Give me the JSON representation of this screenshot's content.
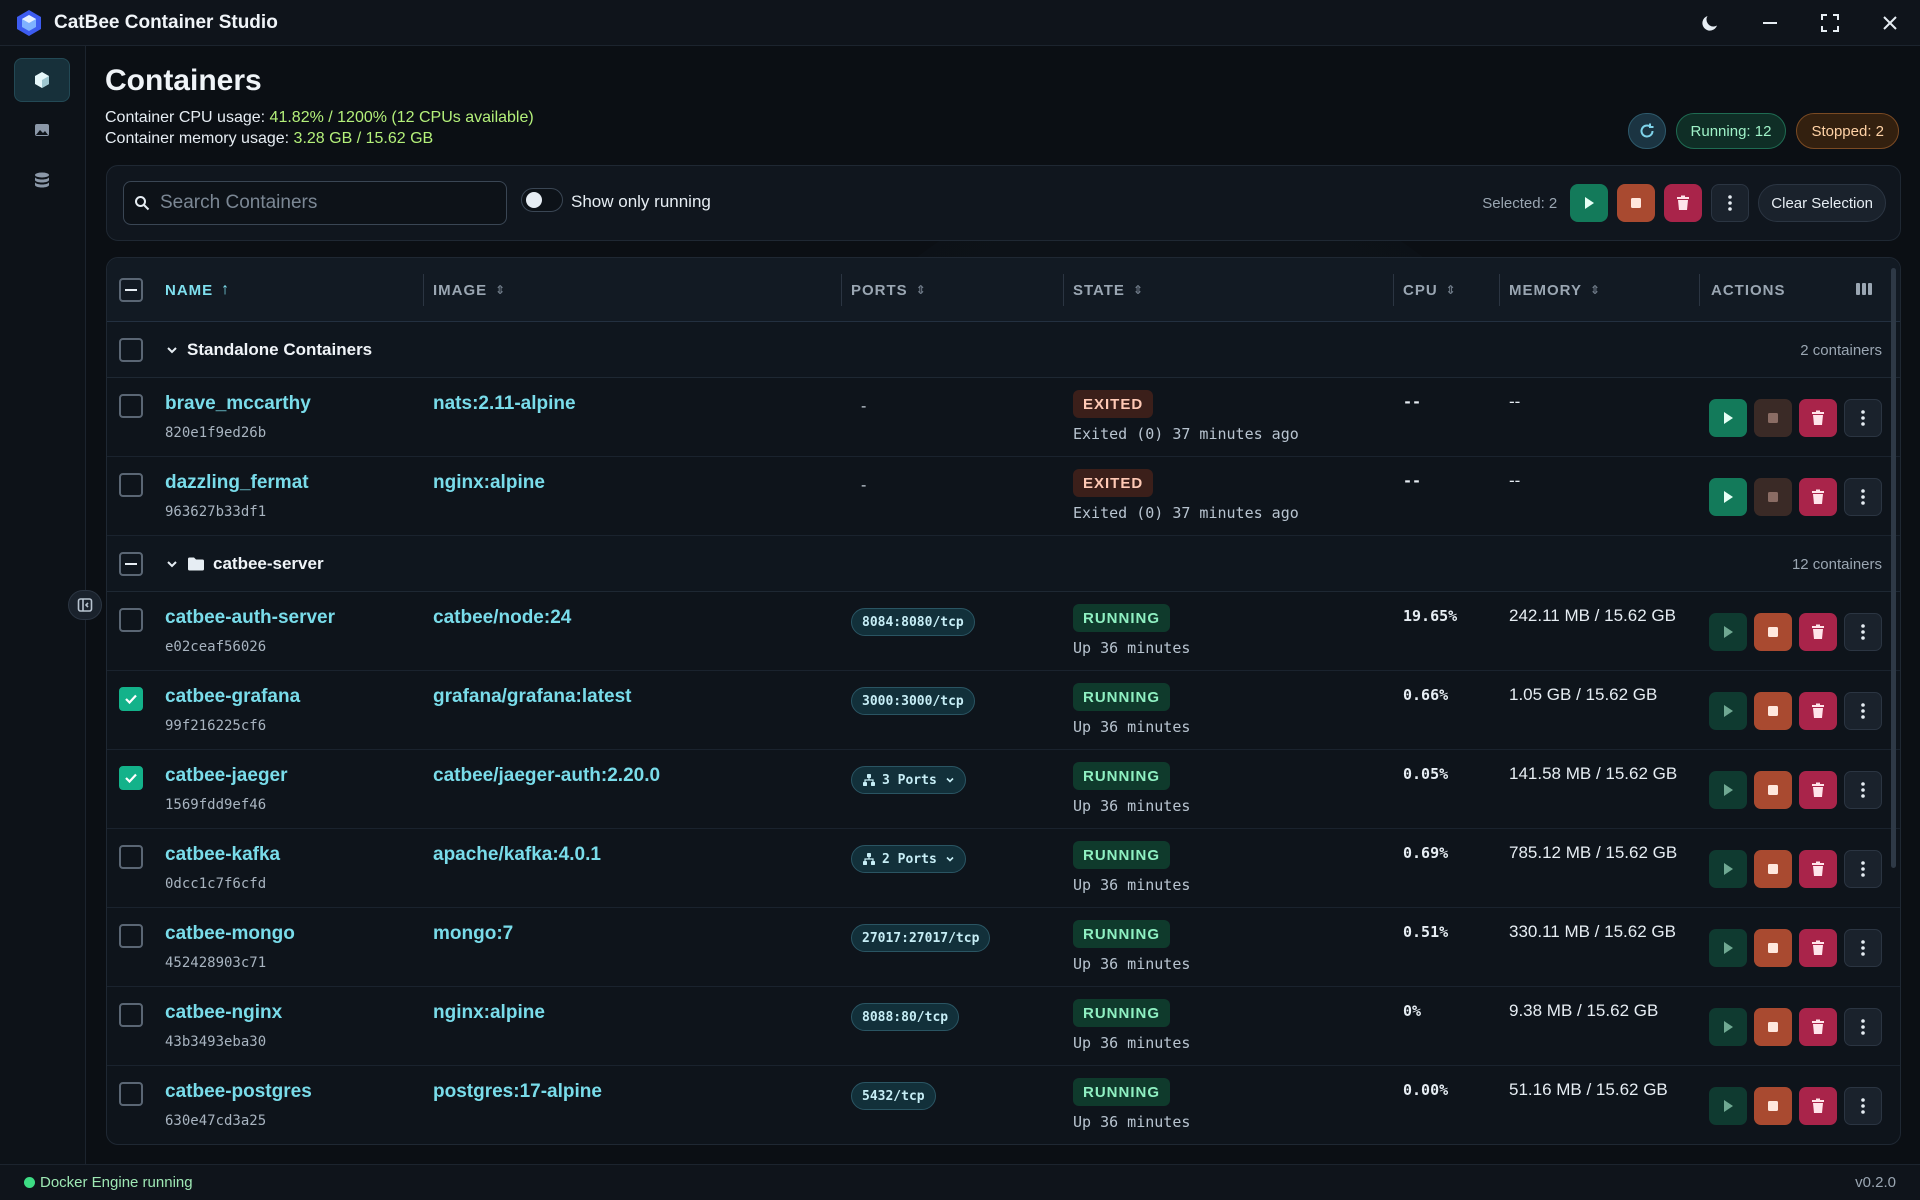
{
  "app": {
    "title": "CatBee Container Studio"
  },
  "window_controls": [
    "theme-toggle",
    "minimize",
    "maximize",
    "close"
  ],
  "sidebar": {
    "items": [
      {
        "name": "containers",
        "icon": "cube-icon",
        "active": true
      },
      {
        "name": "images",
        "icon": "image-icon",
        "active": false
      },
      {
        "name": "volumes",
        "icon": "database-icon",
        "active": false
      }
    ]
  },
  "header": {
    "title": "Containers",
    "cpu_label": "Container CPU usage:",
    "cpu_value": "41.82% / 1200% (12 CPUs available)",
    "mem_label": "Container memory usage:",
    "mem_value": "3.28 GB / 15.62 GB",
    "running": "Running: 12",
    "stopped": "Stopped: 2"
  },
  "toolbar": {
    "search_placeholder": "Search Containers",
    "toggle_label": "Show only running",
    "selected": "Selected: 2",
    "clear": "Clear Selection"
  },
  "table": {
    "headers": {
      "name": "NAME",
      "image": "IMAGE",
      "ports": "PORTS",
      "state": "STATE",
      "cpu": "CPU",
      "memory": "MEMORY",
      "actions": "ACTIONS"
    },
    "groups": [
      {
        "name": "Standalone Containers",
        "count": "2 containers"
      },
      {
        "name": "catbee-server",
        "count": "12 containers"
      }
    ],
    "rows": [
      {
        "name": "brave_mccarthy",
        "id": "820e1f9ed26b",
        "image": "nats:2.11-alpine",
        "ports": "-",
        "state": "EXITED",
        "status": "Exited (0) 37 minutes ago",
        "cpu": "--",
        "mem": "--"
      },
      {
        "name": "dazzling_fermat",
        "id": "963627b33df1",
        "image": "nginx:alpine",
        "ports": "-",
        "state": "EXITED",
        "status": "Exited (0) 37 minutes ago",
        "cpu": "--",
        "mem": "--"
      },
      {
        "name": "catbee-auth-server",
        "id": "e02ceaf56026",
        "image": "catbee/node:24",
        "ports": "8084:8080/tcp",
        "state": "RUNNING",
        "status": "Up 36 minutes",
        "cpu": "19.65%",
        "mem": "242.11 MB / 15.62 GB"
      },
      {
        "name": "catbee-grafana",
        "id": "99f216225cf6",
        "image": "grafana/grafana:latest",
        "ports": "3000:3000/tcp",
        "state": "RUNNING",
        "status": "Up 36 minutes",
        "cpu": "0.66%",
        "mem": "1.05 GB / 15.62 GB"
      },
      {
        "name": "catbee-jaeger",
        "id": "1569fdd9ef46",
        "image": "catbee/jaeger-auth:2.20.0",
        "ports": "3 Ports",
        "state": "RUNNING",
        "status": "Up 36 minutes",
        "cpu": "0.05%",
        "mem": "141.58 MB / 15.62 GB"
      },
      {
        "name": "catbee-kafka",
        "id": "0dcc1c7f6cfd",
        "image": "apache/kafka:4.0.1",
        "ports": "2 Ports",
        "state": "RUNNING",
        "status": "Up 36 minutes",
        "cpu": "0.69%",
        "mem": "785.12 MB / 15.62 GB"
      },
      {
        "name": "catbee-mongo",
        "id": "452428903c71",
        "image": "mongo:7",
        "ports": "27017:27017/tcp",
        "state": "RUNNING",
        "status": "Up 36 minutes",
        "cpu": "0.51%",
        "mem": "330.11 MB / 15.62 GB"
      },
      {
        "name": "catbee-nginx",
        "id": "43b3493eba30",
        "image": "nginx:alpine",
        "ports": "8088:80/tcp",
        "state": "RUNNING",
        "status": "Up 36 minutes",
        "cpu": "0%",
        "mem": "9.38 MB / 15.62 GB"
      },
      {
        "name": "catbee-postgres",
        "id": "630e47cd3a25",
        "image": "postgres:17-alpine",
        "ports": "5432/tcp",
        "state": "RUNNING",
        "status": "Up 36 minutes",
        "cpu": "0.00%",
        "mem": "51.16 MB / 15.62 GB"
      }
    ]
  },
  "statusbar": {
    "engine": "Docker Engine running",
    "version": "v0.2.0"
  },
  "colors": {
    "accent": "#79dcea",
    "running": "#137a5a",
    "stop": "#a94a30",
    "delete": "#a9244a"
  }
}
